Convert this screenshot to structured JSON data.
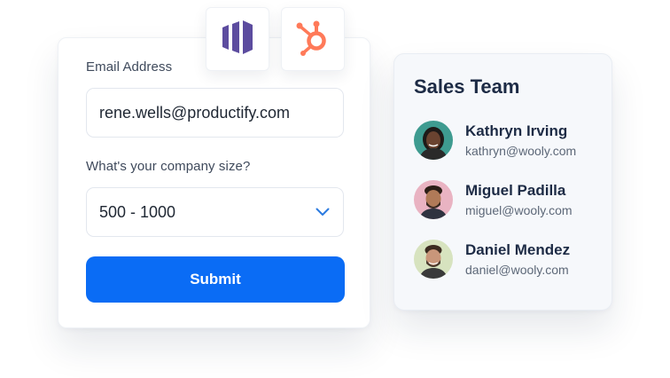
{
  "form": {
    "email_label": "Email Address",
    "email_value": "rene.wells@productify.com",
    "size_label": "What's your company size?",
    "size_value": "500 - 1000",
    "submit_label": "Submit",
    "colors": {
      "primary": "#0a6cf5",
      "chevron": "#2c7be0"
    }
  },
  "integrations": [
    {
      "icon": "marketo-logo-icon",
      "color": "#5c4c9f"
    },
    {
      "icon": "hubspot-logo-icon",
      "color": "#ff7a59"
    }
  ],
  "team": {
    "title": "Sales Team",
    "members": [
      {
        "name": "Kathryn Irving",
        "email": "kathryn@wooly.com",
        "avatar_bg": "#3e9b90"
      },
      {
        "name": "Miguel Padilla",
        "email": "miguel@wooly.com",
        "avatar_bg": "#e9b3c2"
      },
      {
        "name": "Daniel Mendez",
        "email": "daniel@wooly.com",
        "avatar_bg": "#d7e3bf"
      }
    ]
  }
}
